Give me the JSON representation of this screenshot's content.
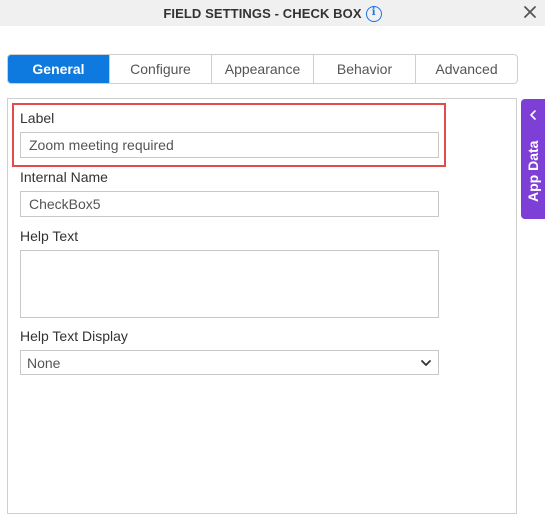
{
  "header": {
    "title": "FIELD SETTINGS - CHECK BOX"
  },
  "tabs": [
    {
      "label": "General",
      "active": true
    },
    {
      "label": "Configure",
      "active": false
    },
    {
      "label": "Appearance",
      "active": false
    },
    {
      "label": "Behavior",
      "active": false
    },
    {
      "label": "Advanced",
      "active": false
    }
  ],
  "form": {
    "label": {
      "label": "Label",
      "value": "Zoom meeting required"
    },
    "internal_name": {
      "label": "Internal Name",
      "value": "CheckBox5"
    },
    "help_text": {
      "label": "Help Text",
      "value": ""
    },
    "help_text_display": {
      "label": "Help Text Display",
      "value": "None"
    }
  },
  "side_panel": {
    "label": "App Data"
  },
  "colors": {
    "accent": "#0e7adf",
    "side_tab": "#7e3fd6",
    "highlight": "#e34b4b",
    "info": "#1a73e8"
  },
  "icons": [
    "info-icon",
    "close-icon",
    "chevron-down-icon",
    "chevron-left-icon"
  ]
}
